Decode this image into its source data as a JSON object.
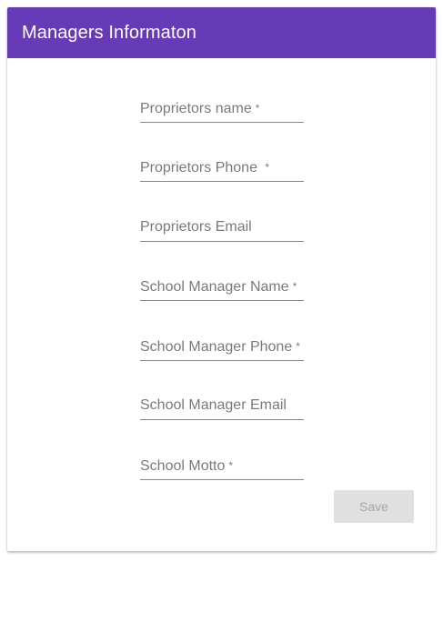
{
  "header": {
    "title": "Managers Informaton",
    "color": "#673ab7"
  },
  "form": {
    "fields": [
      {
        "label": "Proprietors name",
        "required": "*"
      },
      {
        "label": "Proprietors Phone ",
        "required": "*"
      },
      {
        "label": "Proprietors Email",
        "required": ""
      },
      {
        "label": "School Manager Name",
        "required": "*"
      },
      {
        "label": "School Manager Phone",
        "required": "*"
      },
      {
        "label": "School Manager Email",
        "required": ""
      },
      {
        "label": "School Motto",
        "required": "*"
      }
    ],
    "save_label": "Save"
  }
}
